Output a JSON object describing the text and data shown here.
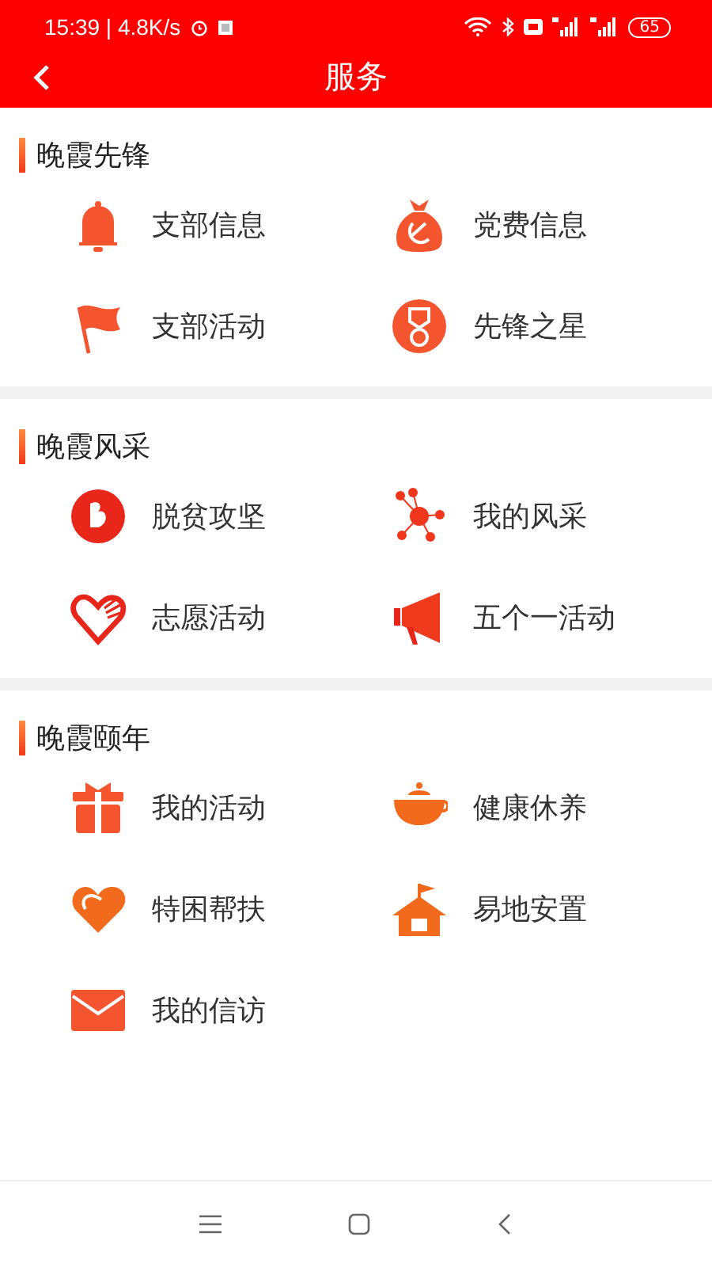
{
  "status_bar": {
    "time": "15:39 | 4.8K/s",
    "battery": "65"
  },
  "header": {
    "title": "服务"
  },
  "sections": [
    {
      "title": "晚霞先锋",
      "items": [
        {
          "label": "支部信息",
          "kind": "bell"
        },
        {
          "label": "党费信息",
          "kind": "bag"
        },
        {
          "label": "支部活动",
          "kind": "flag"
        },
        {
          "label": "先锋之星",
          "kind": "medal"
        }
      ]
    },
    {
      "title": "晚霞风采",
      "items": [
        {
          "label": "脱贫攻坚",
          "kind": "badge"
        },
        {
          "label": "我的风采",
          "kind": "network"
        },
        {
          "label": "志愿活动",
          "kind": "hearthand"
        },
        {
          "label": "五个一活动",
          "kind": "megaphone"
        }
      ]
    },
    {
      "title": "晚霞颐年",
      "items": [
        {
          "label": "我的活动",
          "kind": "gift"
        },
        {
          "label": "健康休养",
          "kind": "teapot"
        },
        {
          "label": "特困帮扶",
          "kind": "heart"
        },
        {
          "label": "易地安置",
          "kind": "house"
        },
        {
          "label": "我的信访",
          "kind": "envelope"
        }
      ]
    }
  ]
}
